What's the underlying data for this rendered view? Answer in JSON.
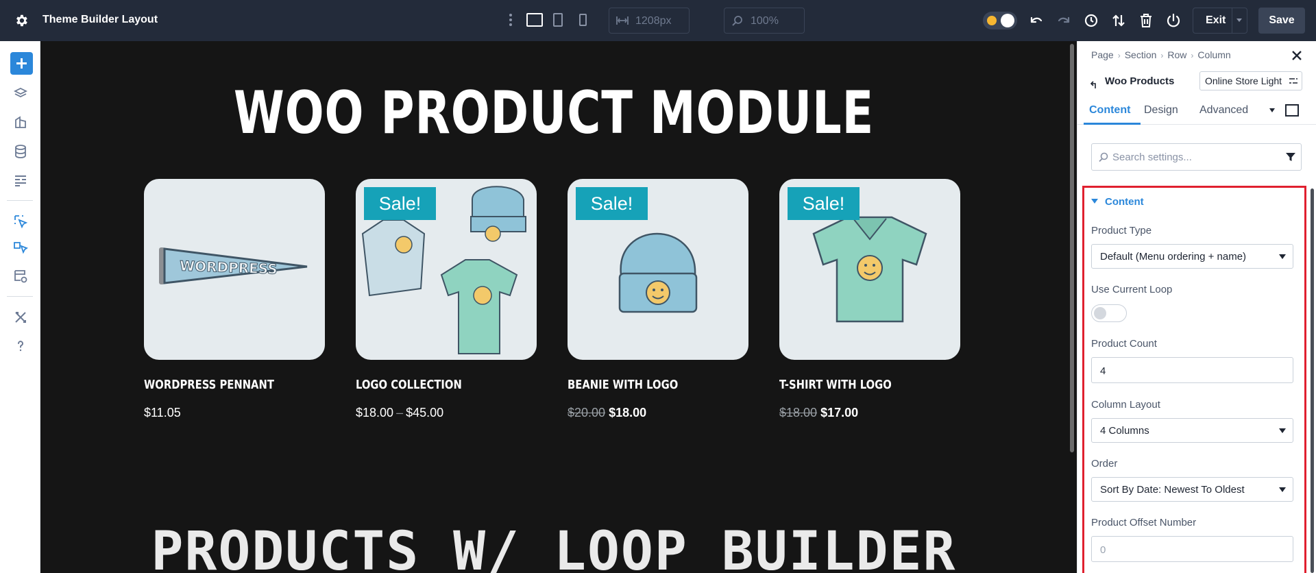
{
  "topbar": {
    "title": "Theme Builder Layout",
    "width_value": "1208px",
    "zoom_value": "100%",
    "exit_label": "Exit",
    "save_label": "Save"
  },
  "canvas": {
    "heading": "WOO PRODUCT MODULE",
    "heading2": "PRODUCTS W/ LOOP BUILDER",
    "products": [
      {
        "name": "WORDPRESS PENNANT",
        "price": "$11.05",
        "badge": ""
      },
      {
        "name": "LOGO COLLECTION",
        "price_min": "$18.00",
        "price_sep": "–",
        "price_max": "$45.00",
        "badge": "Sale!"
      },
      {
        "name": "BEANIE WITH LOGO",
        "old_price": "$20.00",
        "new_price": "$18.00",
        "badge": "Sale!"
      },
      {
        "name": "T-SHIRT WITH LOGO",
        "old_price": "$18.00",
        "new_price": "$17.00",
        "badge": "Sale!"
      }
    ],
    "product_images": [
      "pennant-image",
      "hoodie-beanie-tshirt-image",
      "beanie-image",
      "tshirt-image"
    ]
  },
  "panel": {
    "breadcrumbs": [
      "Page",
      "Section",
      "Row",
      "Column"
    ],
    "module_name": "Woo Products",
    "preset": "Online Store Light",
    "tabs": [
      "Content",
      "Design",
      "Advanced"
    ],
    "search_placeholder": "Search settings...",
    "section_title": "Content",
    "fields": {
      "product_type_label": "Product Type",
      "product_type_value": "Default (Menu ordering + name)",
      "use_current_loop_label": "Use Current Loop",
      "use_current_loop_on": false,
      "product_count_label": "Product Count",
      "product_count_value": "4",
      "column_layout_label": "Column Layout",
      "column_layout_value": "4 Columns",
      "order_label": "Order",
      "order_value": "Sort By Date: Newest To Oldest",
      "offset_label": "Product Offset Number",
      "offset_placeholder": "0"
    }
  },
  "colors": {
    "topbar_bg": "#232b3a",
    "accent": "#2b87da",
    "sale_badge": "#16a2b8",
    "highlight": "#e0202f",
    "canvas_bg": "#151515"
  }
}
